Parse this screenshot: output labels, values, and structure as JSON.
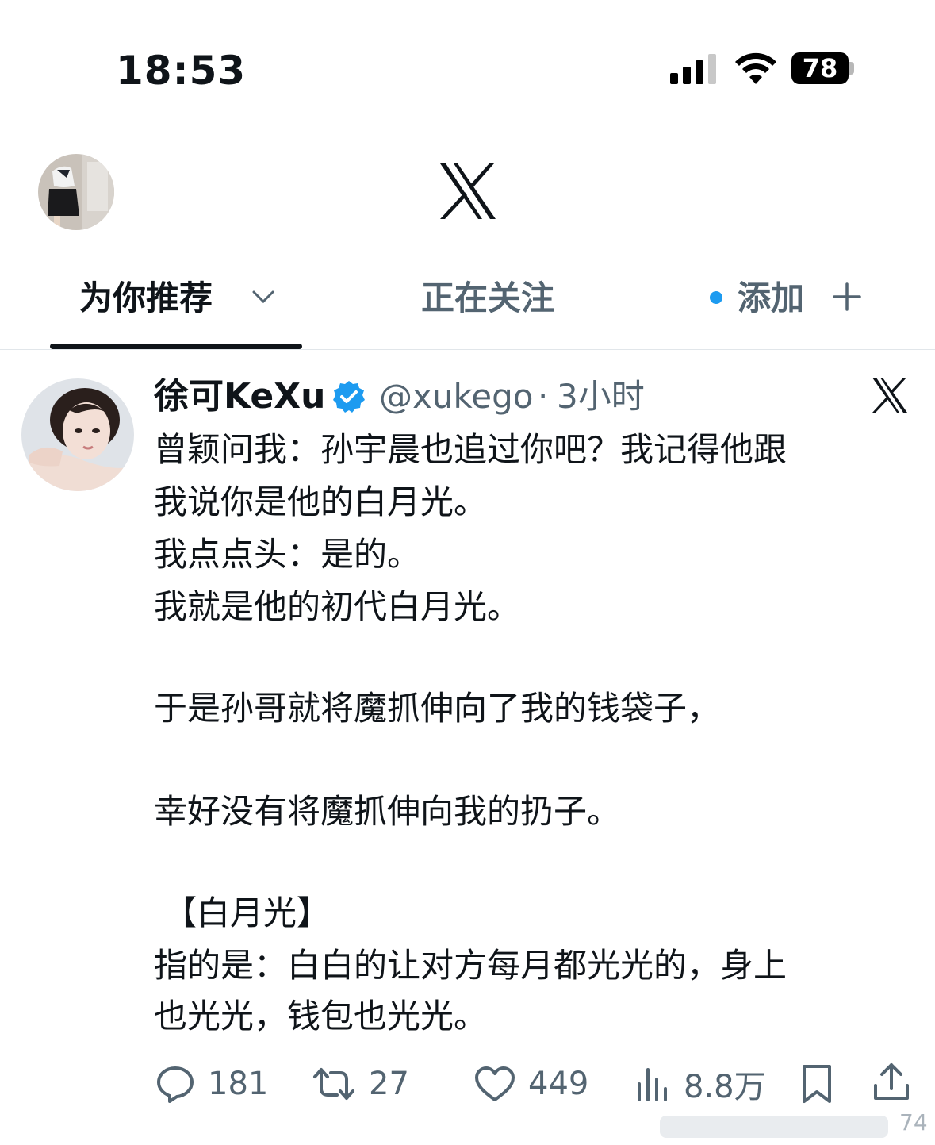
{
  "status_bar": {
    "time": "18:53",
    "battery": "78",
    "icons": [
      "cellular-signal-icon",
      "wifi-icon",
      "battery-icon"
    ]
  },
  "top_bar": {
    "logo": "x-logo-icon",
    "profile_avatar": "profile-avatar"
  },
  "tabs": [
    {
      "label": "为你推荐",
      "active": true
    },
    {
      "label": "正在关注",
      "active": false
    },
    {
      "label": "添加",
      "active": false
    }
  ],
  "post": {
    "author": "徐可KeXu",
    "handle": "@xukego",
    "separator": "·",
    "time_ago": "3小时",
    "lines": [
      "曾颖问我：孙宇晨也追过你吧？我记得他跟",
      "我说你是他的白月光。",
      "我点点头：是的。",
      "我就是他的初代白月光。",
      "于是孙哥就将魔抓伸向了我的钱袋子，",
      "幸好没有将魔抓伸向我的扔子。",
      "【白月光】",
      "指的是：白白的让对方每月都光光的，身上",
      "也光光，钱包也光光。"
    ],
    "stats": {
      "replies": "181",
      "reposts": "27",
      "likes": "449",
      "views": "8.8万"
    }
  },
  "page_number": "74",
  "colors": {
    "accent": "#1d9bf0",
    "text": "#0f1419",
    "secondary": "#536471"
  }
}
